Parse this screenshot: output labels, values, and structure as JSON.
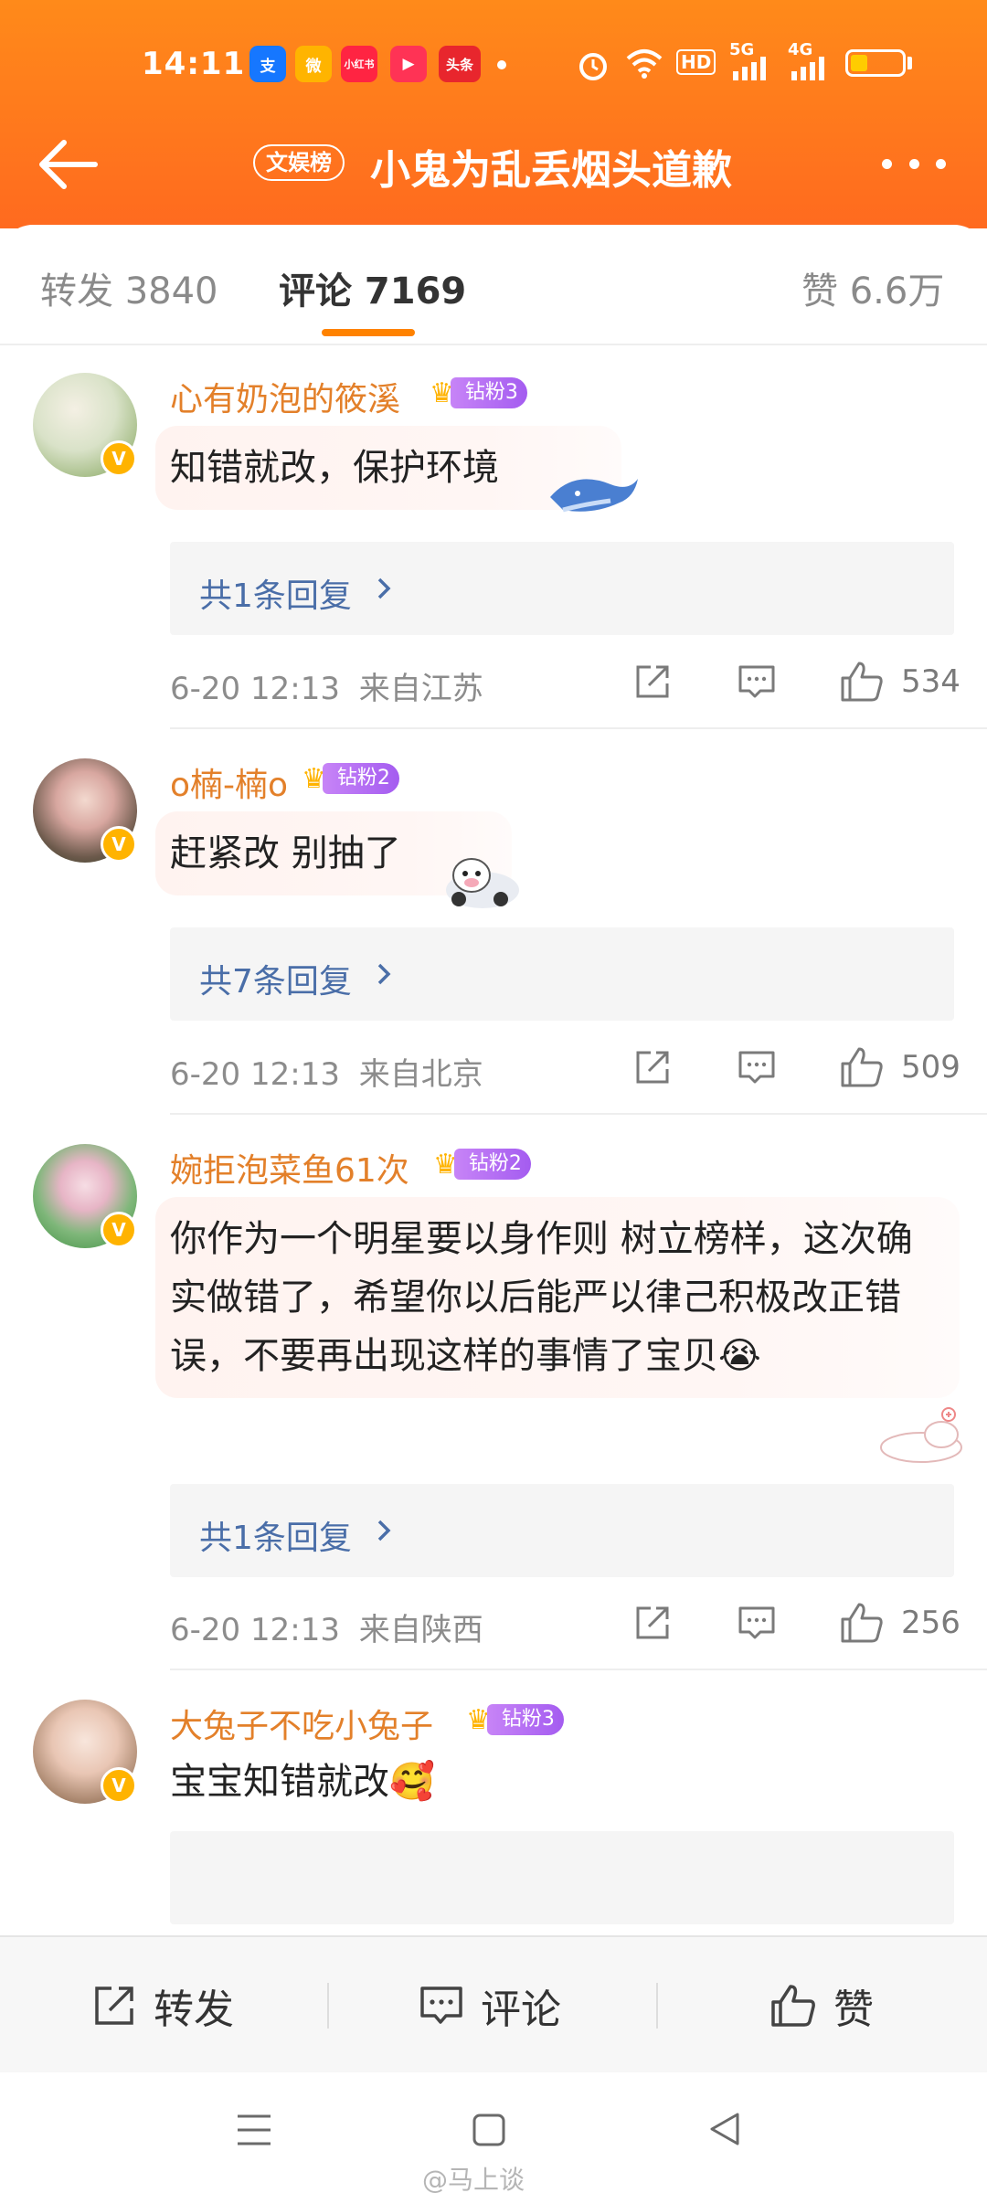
{
  "status_bar": {
    "time": "14:11",
    "apps": [
      {
        "icon": "alipay-icon",
        "label": "支",
        "color": "#1677ff"
      },
      {
        "icon": "weibo-icon",
        "label": "微",
        "color": "#ff9d00"
      },
      {
        "icon": "xiaohongshu-icon",
        "label": "小红书",
        "color": "#ff2442"
      },
      {
        "icon": "video-icon",
        "label": "▶",
        "color": "#ff3355"
      },
      {
        "icon": "toutiao-icon",
        "label": "头条",
        "color": "#e8262d"
      }
    ],
    "hd": "HD",
    "sig1": "5G",
    "sig2": "4G"
  },
  "navbar": {
    "tag": "文娱榜",
    "title": "小鬼为乱丢烟头道歉"
  },
  "tabs": [
    {
      "label": "转发 3840",
      "active": false
    },
    {
      "label": "评论 7169",
      "active": true
    },
    {
      "label": "赞 6.6万",
      "active": false
    }
  ],
  "comments": [
    {
      "username": "心有奶泡的筱溪",
      "fan_level": "钻粉3",
      "text": "知错就改，保护环境",
      "reply": "共1条回复",
      "time": "6-20 12:13",
      "location": "来自江苏",
      "likes": "534"
    },
    {
      "username": "o楠-楠o",
      "fan_level": "钻粉2",
      "text": "赶紧改 别抽了",
      "reply": "共7条回复",
      "time": "6-20 12:13",
      "location": "来自北京",
      "likes": "509"
    },
    {
      "username": "婉拒泡菜鱼61次",
      "fan_level": "钻粉2",
      "text": "你作为一个明星要以身作则 树立榜样，这次确实做错了，希望你以后能严以律己积极改正错误，不要再出现这样的事情了宝贝😭",
      "reply": "共1条回复",
      "time": "6-20 12:13",
      "location": "来自陕西",
      "likes": "256"
    },
    {
      "username": "大兔子不吃小兔子",
      "fan_level": "钻粉3",
      "text": "宝宝知错就改🥰",
      "reply": "",
      "time": "",
      "location": "",
      "likes": ""
    }
  ],
  "toolbar": {
    "repost": "转发",
    "comment": "评论",
    "like": "赞"
  },
  "watermark": "@马上谈",
  "colors": {
    "header": "#ff7a1c",
    "username": "#e3802a",
    "reply_link": "#4a6ea8",
    "tab_indicator": "#ff8200"
  }
}
